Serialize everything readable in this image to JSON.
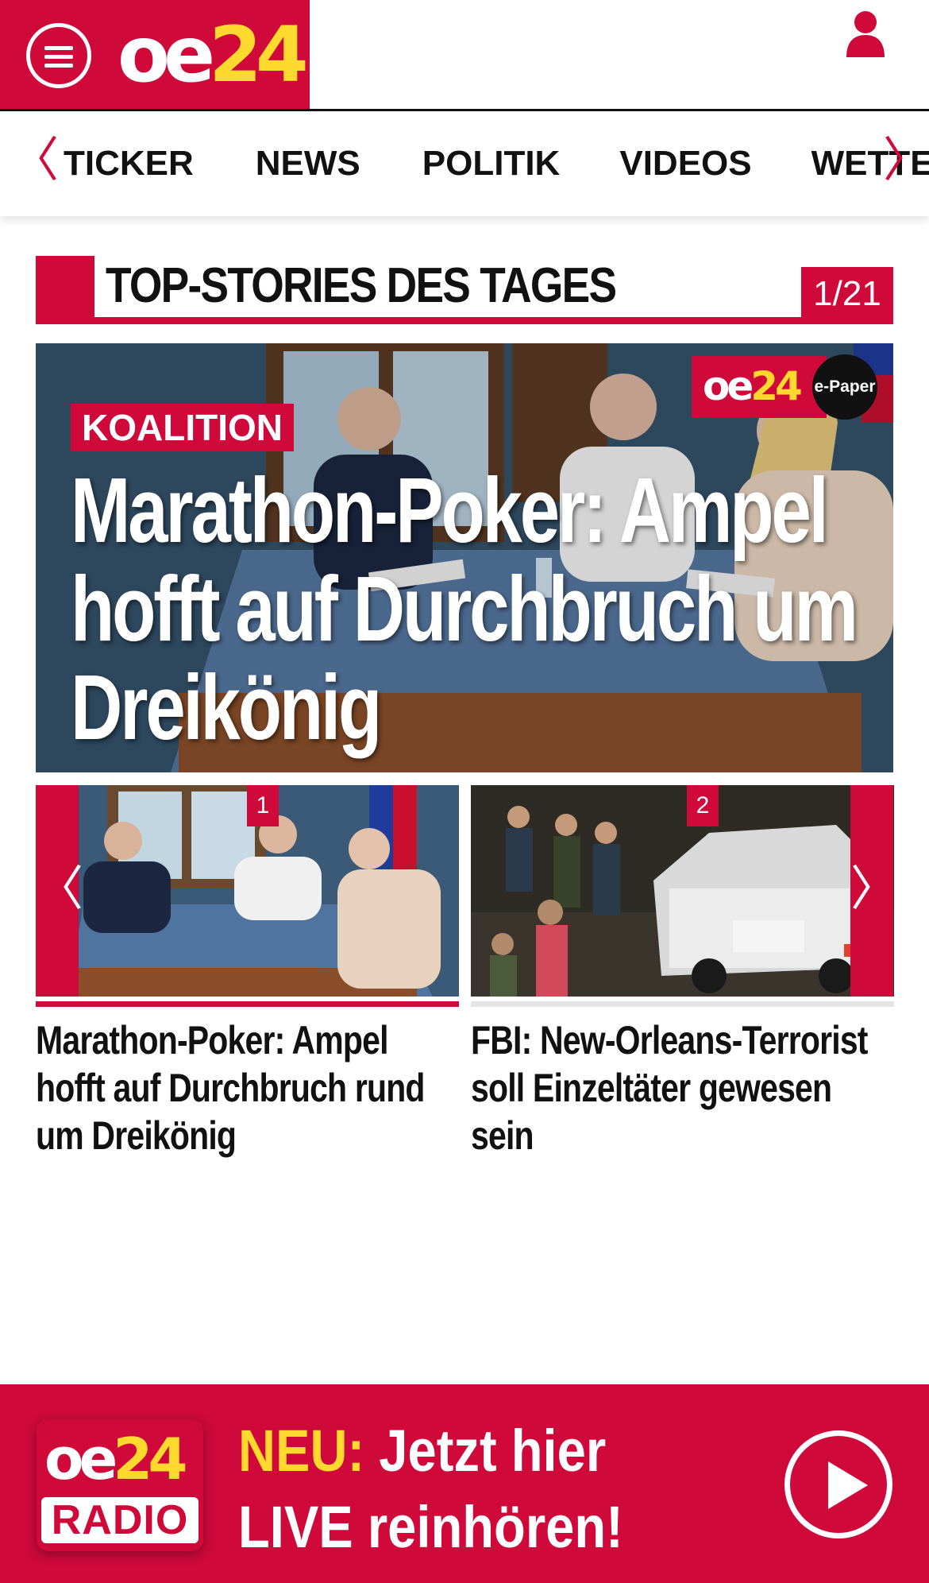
{
  "header": {
    "logo_prefix": "oe",
    "logo_number": "24"
  },
  "nav": {
    "prev_arrow": "〈",
    "next_arrow": "〉",
    "items": [
      "TICKER",
      "NEWS",
      "POLITIK",
      "VIDEOS",
      "WETTER"
    ]
  },
  "section": {
    "title": "TOP-STORIES DES TAGES",
    "counter": "1/21"
  },
  "hero": {
    "badge": "KOALITION",
    "headline": "Marathon-Poker: Ampel hofft auf Durchbruch um Dreikönig",
    "epaper_logo_prefix": "oe",
    "epaper_logo_number": "24",
    "epaper_label": "e-Paper"
  },
  "carousel": {
    "prev_arrow": "〈",
    "next_arrow": "〉",
    "cards": [
      {
        "number": "1",
        "caption": "Marathon-Poker: Ampel hofft auf Durchbruch rund um Dreikönig"
      },
      {
        "number": "2",
        "caption": "FBI: New-Orleans-Terrorist soll Einzeltäter gewesen sein"
      }
    ]
  },
  "radio": {
    "logo_prefix": "oe",
    "logo_number": "24",
    "logo_label": "RADIO",
    "neu": "NEU:",
    "line1": "Jetzt hier",
    "line2": "LIVE reinhören!"
  },
  "colors": {
    "brand_red": "#cf0a3b",
    "brand_yellow": "#ffd92e"
  },
  "icons": [
    "menu-icon",
    "user-icon",
    "play-icon",
    "chevron-left-icon",
    "chevron-right-icon"
  ]
}
